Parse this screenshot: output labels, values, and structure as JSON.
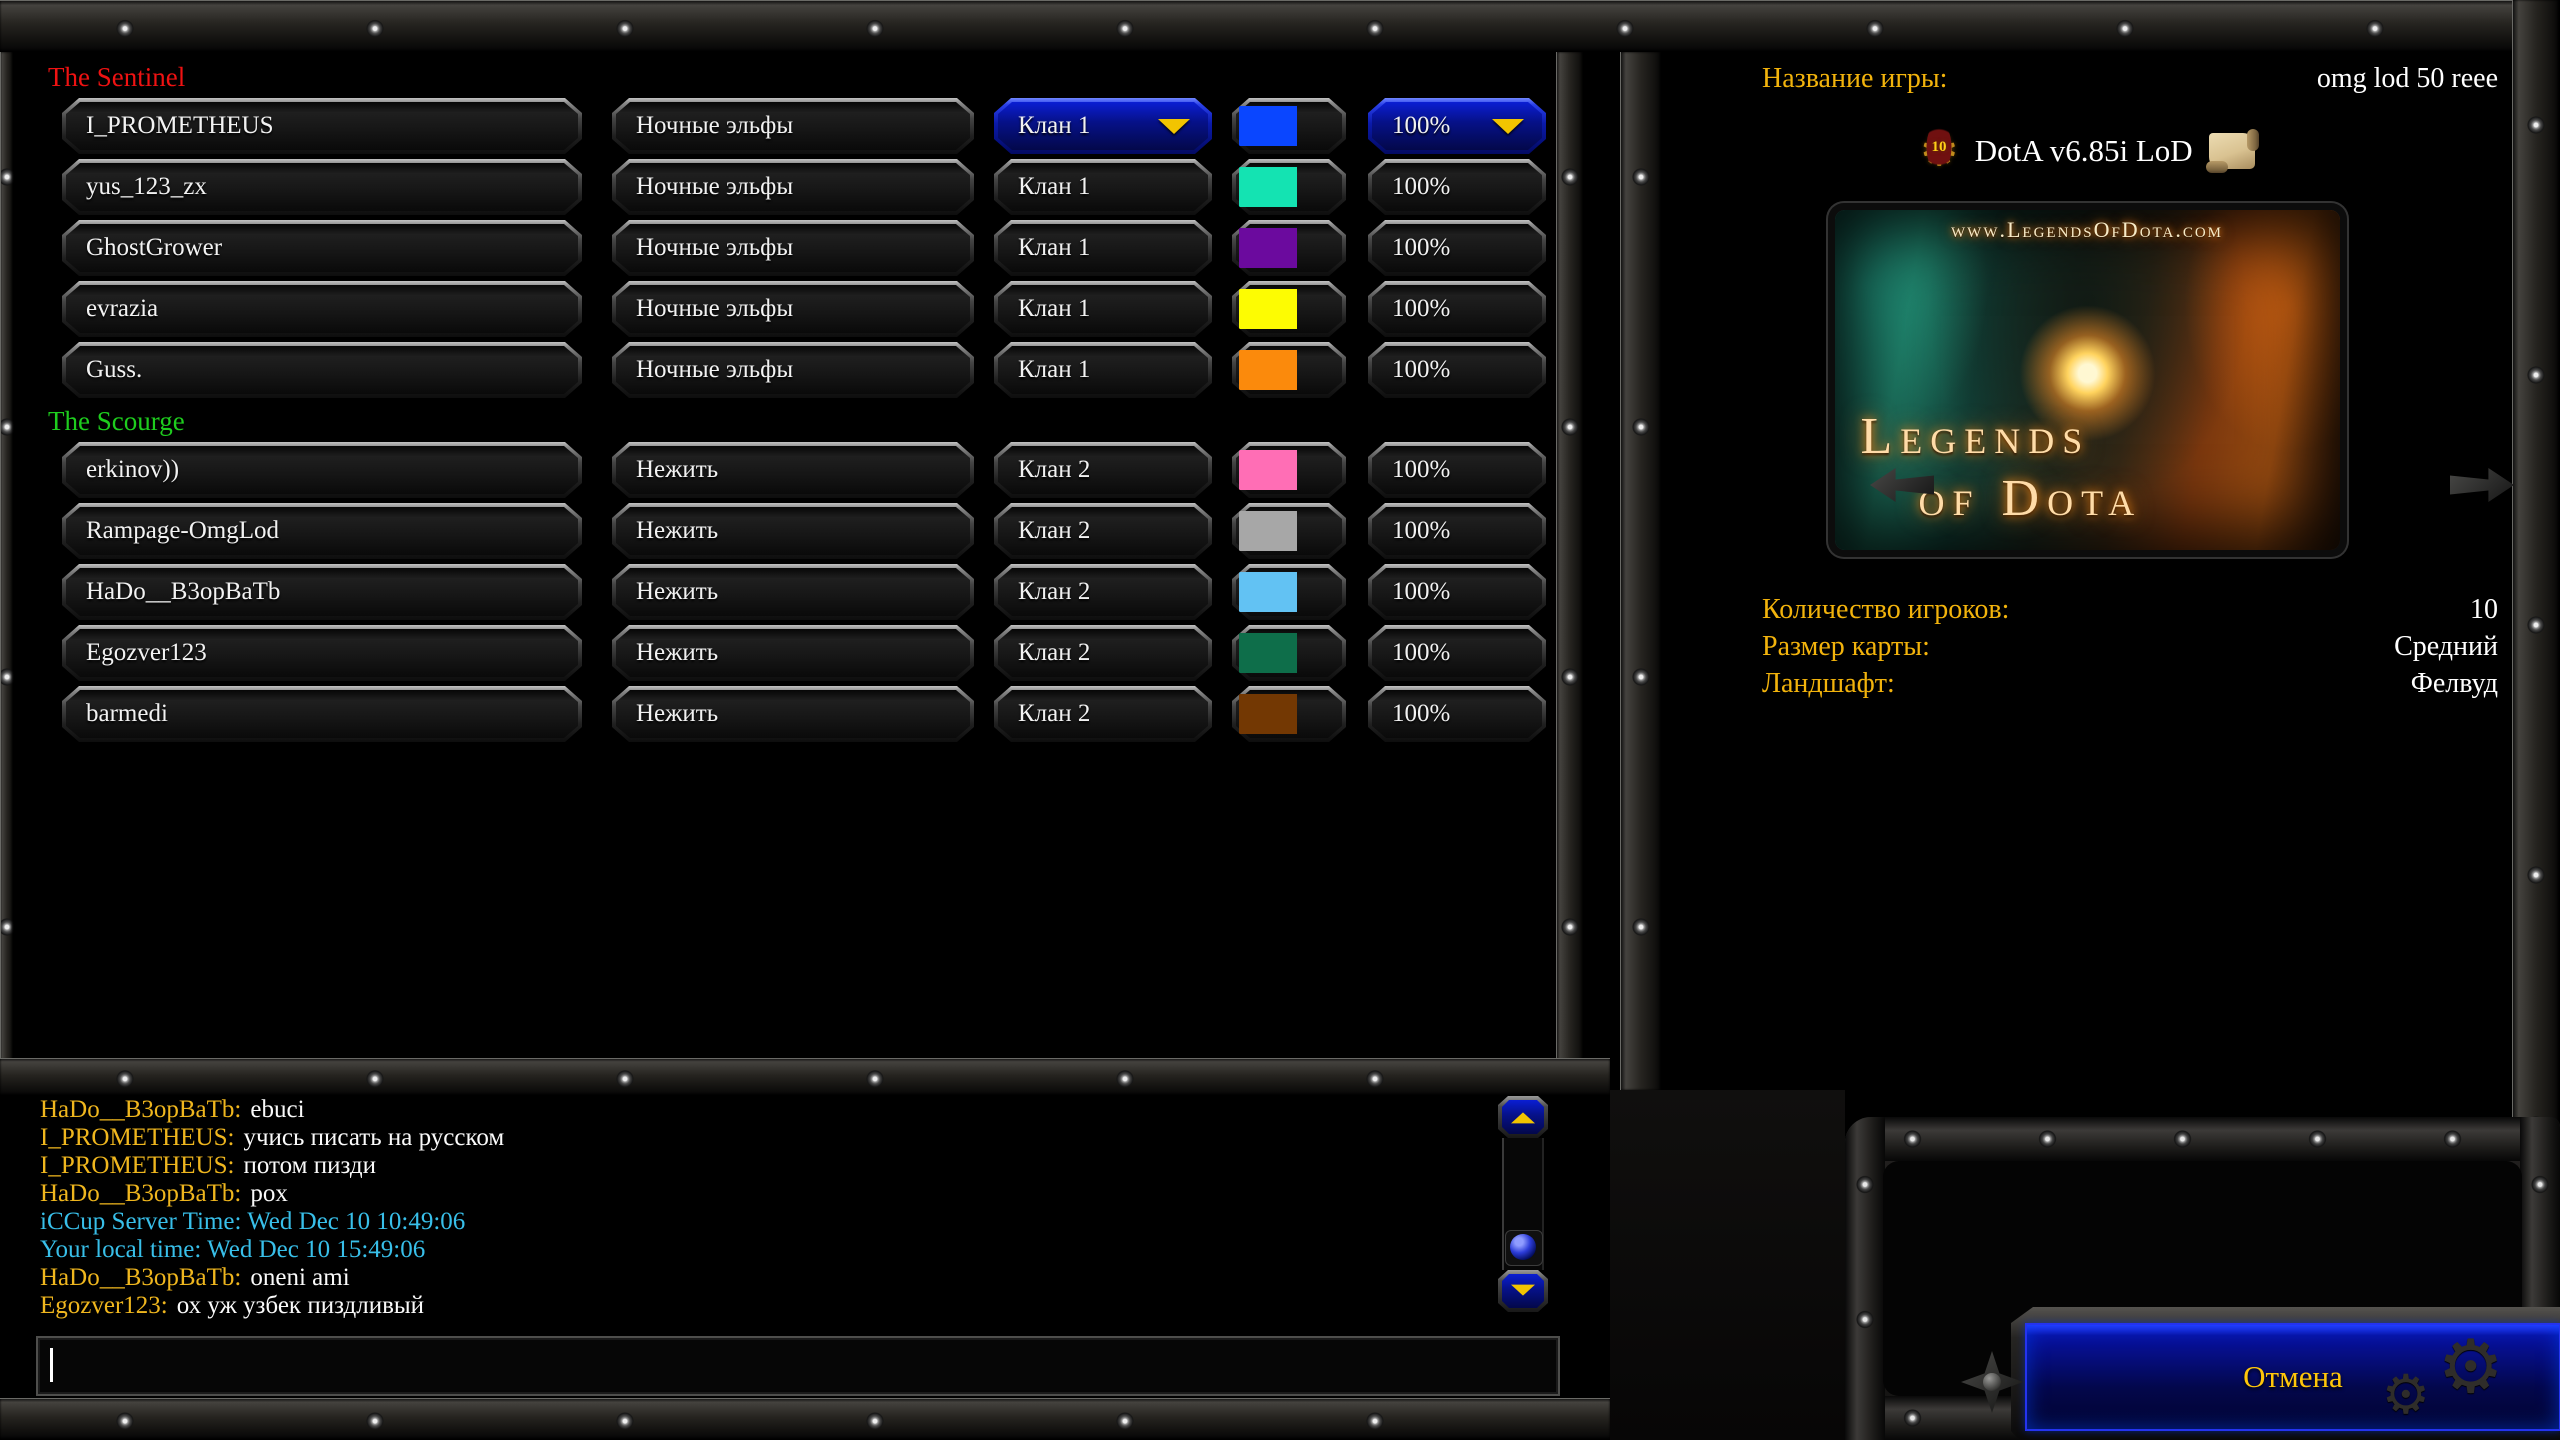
{
  "teams": [
    {
      "name": "The Sentinel",
      "label_color": "#ef1212",
      "players": [
        {
          "name": "I_PROMETHEUS",
          "race": "Ночные эльфы",
          "clan": "Клан 1",
          "color": "#0a46ff",
          "handicap": "100%"
        },
        {
          "name": "yus_123_zx",
          "race": "Ночные эльфы",
          "clan": "Клан 1",
          "color": "#14e3b2",
          "handicap": "100%"
        },
        {
          "name": "GhostGrower",
          "race": "Ночные эльфы",
          "clan": "Клан 1",
          "color": "#6b0a9e",
          "handicap": "100%"
        },
        {
          "name": "evrazia",
          "race": "Ночные эльфы",
          "clan": "Клан 1",
          "color": "#fdfc02",
          "handicap": "100%"
        },
        {
          "name": "Guss.",
          "race": "Ночные эльфы",
          "clan": "Клан 1",
          "color": "#fb8a0c",
          "handicap": "100%"
        }
      ]
    },
    {
      "name": "The Scourge",
      "label_color": "#1ecd1e",
      "players": [
        {
          "name": "erkinov))",
          "race": "Нежить",
          "clan": "Клан 2",
          "color": "#ff6eb5",
          "handicap": "100%"
        },
        {
          "name": "Rampage-OmgLod",
          "race": "Нежить",
          "clan": "Клан 2",
          "color": "#a7a7a7",
          "handicap": "100%"
        },
        {
          "name": "HaDo__B3opBaTb",
          "race": "Нежить",
          "clan": "Клан 2",
          "color": "#62c2f3",
          "handicap": "100%"
        },
        {
          "name": "Egozver123",
          "race": "Нежить",
          "clan": "Клан 2",
          "color": "#0e6e4a",
          "handicap": "100%"
        },
        {
          "name": "barmedi",
          "race": "Нежить",
          "clan": "Клан 2",
          "color": "#733803",
          "handicap": "100%"
        }
      ]
    }
  ],
  "game_info": {
    "name_label": "Название игры:",
    "name_value": "omg lod 50 reee",
    "map_badge": "10",
    "map_title": "DotA v6.85i LoD",
    "map_preview_url": "www.LegendsOfDota.com",
    "map_preview_title_line1": "Legends",
    "map_preview_title_line2": "of Dota",
    "players_label": "Количество игроков:",
    "players_value": "10",
    "size_label": "Размер карты:",
    "size_value": "Средний",
    "terrain_label": "Ландшафт:",
    "terrain_value": "Фелвуд"
  },
  "chat": {
    "lines": [
      {
        "prefix": "HaDo__B3opBaTb:",
        "text": "ebuci"
      },
      {
        "prefix": "I_PROMETHEUS:",
        "text": "учись писать на русском"
      },
      {
        "prefix": "I_PROMETHEUS:",
        "text": "потом пизди"
      },
      {
        "prefix": "HaDo__B3opBaTb:",
        "text": "pox"
      },
      {
        "text": "iCCup Server Time: Wed Dec 10 10:49:06"
      },
      {
        "text": "Your local time: Wed Dec 10 15:49:06"
      },
      {
        "prefix": "HaDo__B3opBaTb:",
        "text": "oneni ami"
      },
      {
        "prefix": "Egozver123:",
        "text": "ох уж узбек пиздливый"
      }
    ],
    "input_value": ""
  },
  "cancel_label": "Отмена"
}
